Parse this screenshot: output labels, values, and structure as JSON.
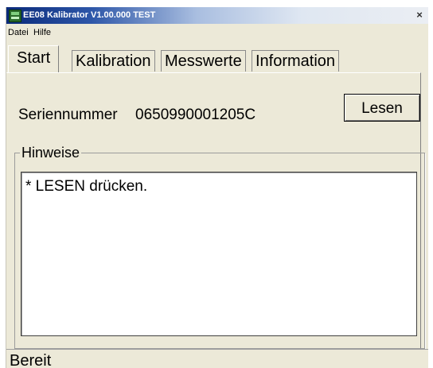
{
  "window": {
    "title": "EE08 Kalibrator V1.00.000 TEST",
    "close_glyph": "×",
    "app_icon": "app-icon"
  },
  "menubar": {
    "items": [
      "Datei",
      "Hilfe"
    ]
  },
  "tabs": [
    {
      "label": "Start",
      "active": true
    },
    {
      "label": "Kalibration",
      "active": false
    },
    {
      "label": "Messwerte",
      "active": false
    },
    {
      "label": "Information",
      "active": false
    }
  ],
  "start": {
    "serial_label": "Seriennummer",
    "serial_value": "0650990001205C",
    "read_button": "Lesen",
    "hints_title": "Hinweise",
    "hints_text": "* LESEN drücken."
  },
  "statusbar": {
    "text": "Bereit"
  },
  "colors": {
    "window_bg": "#ece9d8",
    "title_gradient_start": "#0a2a7a",
    "title_gradient_end": "#ebeef3"
  }
}
